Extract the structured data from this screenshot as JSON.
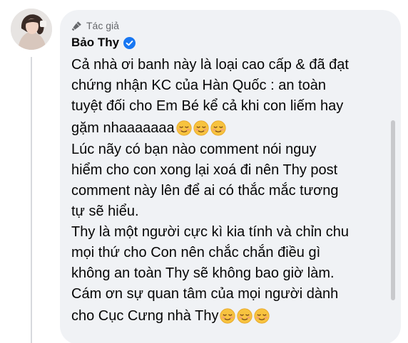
{
  "comment": {
    "author_role": "Tác giả",
    "author_name": "Bảo Thy",
    "paragraph1": {
      "lines": [
        "Cả nhà ơi banh này là loại cao cấp & đã đạt",
        "chứng nhận KC của Hàn Quốc : an toàn",
        "tuyệt đối cho Em Bé kể cả khi con liếm hay"
      ],
      "last_line": "gặm nhaaaaaaa"
    },
    "paragraph2": {
      "lines": [
        "Lúc nãy có bạn nào comment nói nguy",
        "hiểm cho con xong lại xoá đi nên Thy post",
        "comment này lên để ai có thắc mắc tương",
        "tự sẽ hiểu."
      ]
    },
    "paragraph3": {
      "lines": [
        "Thy là một người cực kì kia tính và chỉn chu",
        "mọi thứ cho Con nên chắc chắn điều gì",
        "không an toàn Thy sẽ không bao giờ làm.",
        "Cám ơn sự quan tâm của mọi người dành"
      ],
      "last_line": "cho Cục Cưng nhà Thy"
    },
    "emoji": "smiling-face-emoji",
    "emoji_count": 3
  },
  "colors": {
    "bubble_bg": "#f0f2f5",
    "text": "#050505",
    "muted": "#65676b",
    "verified": "#1877f2",
    "emoji_face": "#f7c33f"
  }
}
